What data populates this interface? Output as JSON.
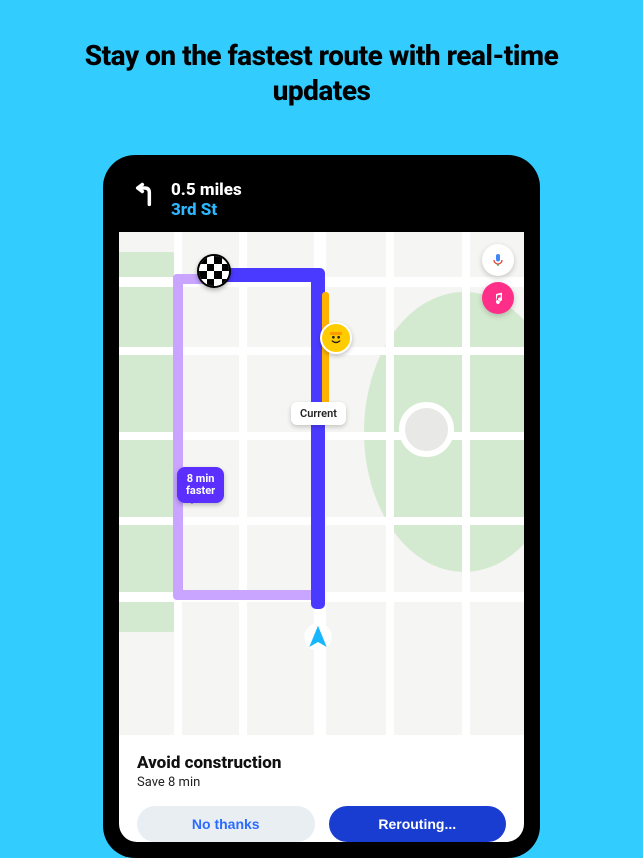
{
  "headline": "Stay on the fastest route with real-time updates",
  "nav": {
    "distance": "0.5 miles",
    "street": "3rd St"
  },
  "map": {
    "current_label": "Current",
    "faster_bubble": "8 min\nfaster",
    "icons": {
      "destination": "destination-flag",
      "construction": "construction-worker",
      "user": "navigation-arrow",
      "mic": "microphone",
      "music": "music-note"
    }
  },
  "card": {
    "title": "Avoid construction",
    "subtitle": "Save 8 min",
    "secondary_label": "No thanks",
    "primary_label": "Rerouting..."
  },
  "colors": {
    "background": "#33ccff",
    "route_current": "#4a3aff",
    "route_alt": "#c9a5ff",
    "traffic": "#ffb300",
    "accent_link": "#2db7ff",
    "primary_btn": "#1a3dd1",
    "music_btn": "#ff2e88"
  }
}
